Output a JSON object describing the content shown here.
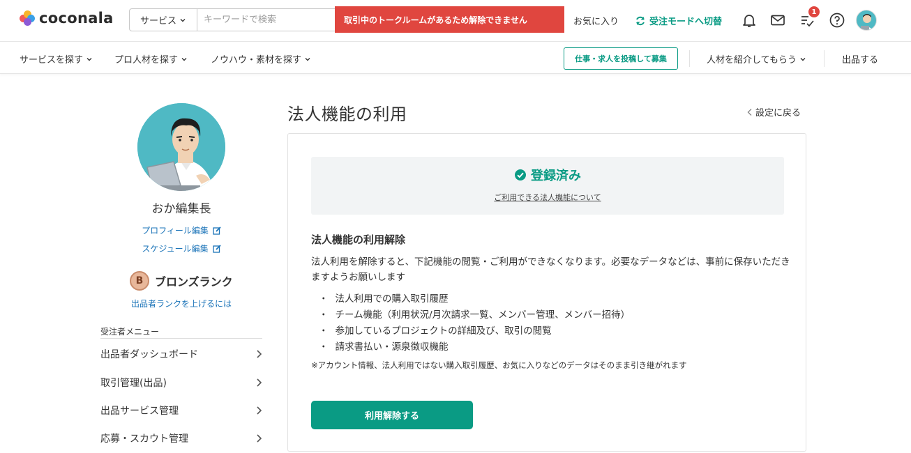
{
  "header": {
    "logo_text": "coconala",
    "search": {
      "category": "サービス",
      "placeholder": "キーワードで検索"
    },
    "alert": "取引中のトークルームがあるため解除できません",
    "favorites": "お気に入り",
    "switch_mode": "受注モードへ切替",
    "todo_badge": "1"
  },
  "subnav": {
    "items": [
      "サービスを探す",
      "プロ人材を探す",
      "ノウハウ・素材を探す"
    ],
    "post_job": "仕事・求人を投稿して募集",
    "referral": "人材を紹介してもらう",
    "sell": "出品する"
  },
  "sidebar": {
    "name": "おか編集長",
    "links": [
      "プロフィール編集",
      "スケジュール編集"
    ],
    "rank_letter": "B",
    "rank": "ブロンズランク",
    "rank_link": "出品者ランクを上げるには",
    "menu_title": "受注者メニュー",
    "menu_items": [
      "出品者ダッシュボード",
      "取引管理(出品)",
      "出品サービス管理",
      "応募・スカウト管理"
    ]
  },
  "main": {
    "title": "法人機能の利用",
    "back": "設定に戻る",
    "status": "登録済み",
    "status_link": "ご利用できる法人機能について",
    "section_title": "法人機能の利用解除",
    "description": "法人利用を解除すると、下記機能の閲覧・ご利用ができなくなります。必要なデータなどは、事前に保存いただきますようお願いします",
    "features": [
      "法人利用での購入取引履歴",
      "チーム機能（利用状況/月次請求一覧、メンバー管理、メンバー招待）",
      "参加しているプロジェクトの詳細及び、取引の閲覧",
      "請求書払い・源泉徴収機能"
    ],
    "note": "※アカウント情報、法人利用ではない購入取引履歴、お気に入りなどのデータはそのまま引き継がれます",
    "cancel_button": "利用解除する"
  },
  "colors": {
    "accent": "#0a9b84",
    "alert": "#e0463f",
    "link": "#1a73b8"
  }
}
